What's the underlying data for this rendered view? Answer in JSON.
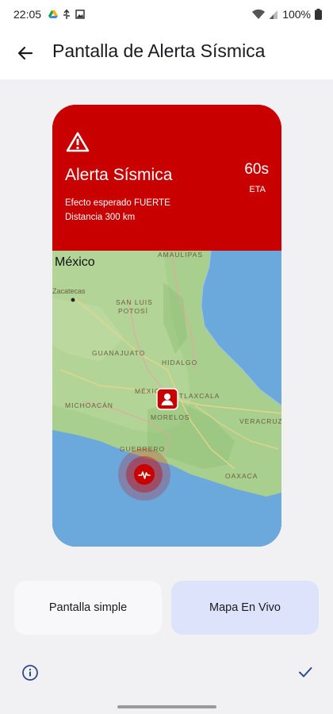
{
  "status_bar": {
    "time": "22:05",
    "battery": "100%"
  },
  "app_bar": {
    "title": "Pantalla de Alerta Sísmica"
  },
  "alert_card": {
    "title": "Alerta Sísmica",
    "eta_value": "60s",
    "eta_label": "ETA",
    "effect": "Efecto esperado FUERTE",
    "distance": "Distancia 300 km",
    "accent_color": "#c80000"
  },
  "map": {
    "country_label": "México",
    "labels": [
      "AMAULIPAS",
      "Zacatecas",
      "SAN LUIS",
      "POTOSÍ",
      "GUANAJUATO",
      "HIDALGO",
      "MÉXICO",
      "TLAXCALA",
      "MICHOACÁN",
      "MORELOS",
      "VERACRUZ",
      "GUERRERO",
      "OAXACA"
    ]
  },
  "buttons": {
    "simple": "Pantalla simple",
    "live": "Mapa En Vivo"
  },
  "icons": {
    "back": "arrow-left-icon",
    "warning": "warning-triangle-icon",
    "user_location": "person-icon",
    "epicenter": "seismic-wave-icon",
    "info": "info-icon",
    "confirm": "check-icon"
  }
}
